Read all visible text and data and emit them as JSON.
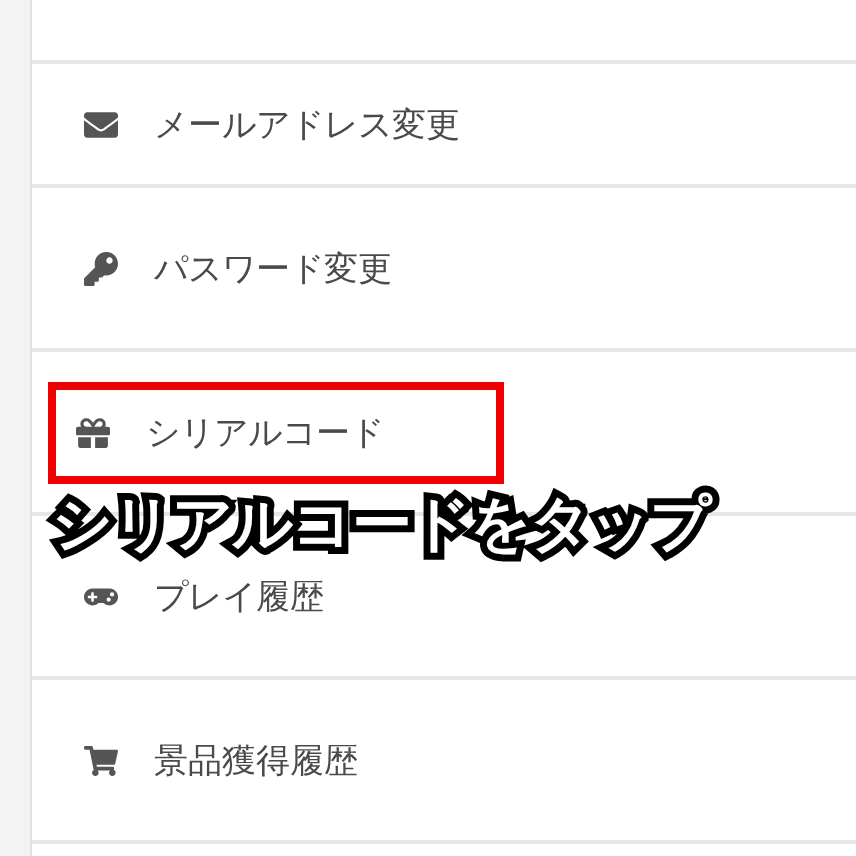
{
  "menu": [
    {
      "label": "メールアドレス変更",
      "highlighted": false
    },
    {
      "label": "パスワード変更",
      "highlighted": false
    },
    {
      "label": "シリアルコード",
      "highlighted": true
    },
    {
      "label": "プレイ履歴",
      "highlighted": false
    },
    {
      "label": "景品獲得履歴",
      "highlighted": false
    }
  ],
  "caption": "シリアルコードをタップ"
}
